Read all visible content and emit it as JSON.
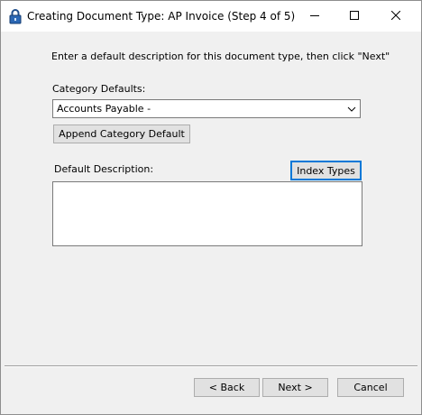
{
  "window": {
    "title": "Creating Document Type: AP Invoice (Step 4 of 5)",
    "icon": "padlock-icon"
  },
  "titlebar_controls": {
    "minimize": "minimize-icon",
    "maximize": "maximize-icon",
    "close": "close-icon"
  },
  "instruction_text": "Enter a default description for this document type, then click \"Next\"",
  "category_defaults": {
    "label": "Category Defaults:",
    "selected_value": "Accounts Payable -"
  },
  "append_button_label": "Append Category Default",
  "default_description": {
    "label": "Default Description:",
    "value": ""
  },
  "index_types_button_label": "Index Types",
  "footer": {
    "back_label": "< Back",
    "next_label": "Next >",
    "cancel_label": "Cancel"
  },
  "colors": {
    "dialog_background": "#f0f0f0",
    "focus_border": "#0078d7",
    "button_face": "#e1e1e1"
  }
}
